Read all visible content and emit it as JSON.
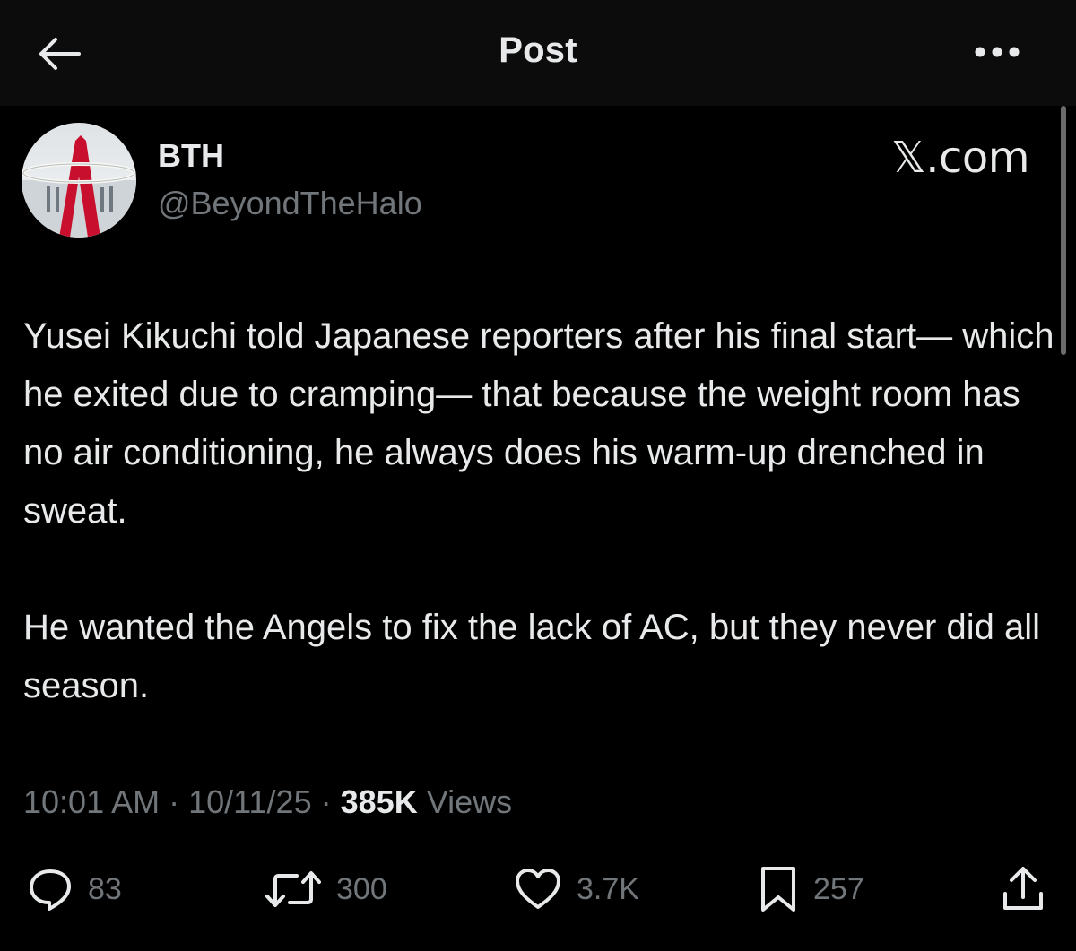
{
  "header": {
    "title": "Post",
    "back_icon": "arrow-left-icon",
    "more_icon": "more-horizontal-icon"
  },
  "author": {
    "display_name": "BTH",
    "handle": "@BeyondTheHalo"
  },
  "source_mark": "𝕏.com",
  "tweet": {
    "paragraphs": [
      "Yusei Kikuchi told Japanese reporters after his final start— which he exited due to cramping— that because the weight room has no air conditioning, he always does his warm-up drenched in sweat.",
      "He wanted the Angels to fix the lack of AC, but they never did all season."
    ]
  },
  "meta": {
    "time": "10:01 AM",
    "separator": "·",
    "date": "10/11/25",
    "views_count": "385K",
    "views_label": "Views"
  },
  "actions": {
    "replies": "83",
    "reposts": "300",
    "likes": "3.7K",
    "bookmarks": "257"
  },
  "colors": {
    "background": "#000000",
    "header_background": "#0c0c0c",
    "primary_text": "#e7e9ea",
    "secondary_text": "#71767b",
    "avatar_accent": "#c8102e"
  }
}
